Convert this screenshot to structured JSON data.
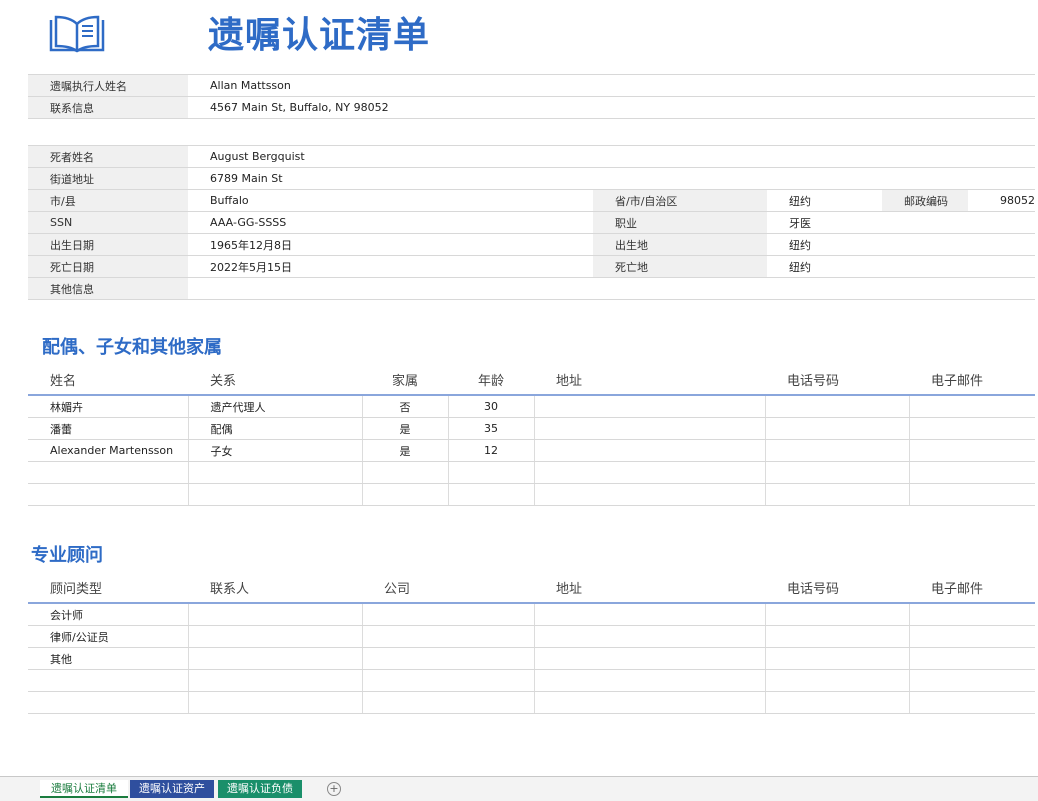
{
  "header": {
    "title": "遗嘱认证清单",
    "icon": "book-icon"
  },
  "executor": {
    "name_label": "遗嘱执行人姓名",
    "name_value": "Allan Mattsson",
    "contact_label": "联系信息",
    "contact_value": "4567 Main St, Buffalo, NY 98052"
  },
  "deceased": {
    "name_label": "死者姓名",
    "name_value": "August Bergquist",
    "street_label": "街道地址",
    "street_value": "6789 Main St",
    "city_label": "市/县",
    "city_value": "Buffalo",
    "province_label": "省/市/自治区",
    "province_value": "纽约",
    "zip_label": "邮政编码",
    "zip_value": "98052",
    "ssn_label": "SSN",
    "ssn_value": "AAA-GG-SSSS",
    "job_label": "职业",
    "job_value": "牙医",
    "dob_label": "出生日期",
    "dob_value": "1965年12月8日",
    "birthplace_label": "出生地",
    "birthplace_value": "纽约",
    "dod_label": "死亡日期",
    "dod_value": "2022年5月15日",
    "deathplace_label": "死亡地",
    "deathplace_value": "纽约",
    "other_label": "其他信息",
    "other_value": ""
  },
  "family": {
    "title": "配偶、子女和其他家属",
    "headers": [
      "姓名",
      "关系",
      "家属",
      "年龄",
      "地址",
      "电话号码",
      "电子邮件"
    ],
    "rows": [
      [
        "林媚卉",
        "遗产代理人",
        "否",
        "30",
        "",
        "",
        ""
      ],
      [
        "潘蕾",
        "配偶",
        "是",
        "35",
        "",
        "",
        ""
      ],
      [
        "Alexander Martensson",
        "子女",
        "是",
        "12",
        "",
        "",
        ""
      ],
      [
        "",
        "",
        "",
        "",
        "",
        "",
        ""
      ],
      [
        "",
        "",
        "",
        "",
        "",
        "",
        ""
      ]
    ]
  },
  "advisors": {
    "title": "专业顾问",
    "headers": [
      "顾问类型",
      "联系人",
      "公司",
      "地址",
      "电话号码",
      "电子邮件"
    ],
    "rows": [
      [
        "会计师",
        "",
        "",
        "",
        "",
        ""
      ],
      [
        "律师/公证员",
        "",
        "",
        "",
        "",
        ""
      ],
      [
        "其他",
        "",
        "",
        "",
        "",
        ""
      ],
      [
        "",
        "",
        "",
        "",
        "",
        ""
      ],
      [
        "",
        "",
        "",
        "",
        "",
        ""
      ]
    ]
  },
  "sheet_tabs": [
    "遗嘱认证清单",
    "遗嘱认证资产",
    "遗嘱认证负债"
  ],
  "colors": {
    "accent": "#2e6bc6",
    "tab_blue": "#2f4f9e",
    "tab_green": "#1a8f6a"
  }
}
